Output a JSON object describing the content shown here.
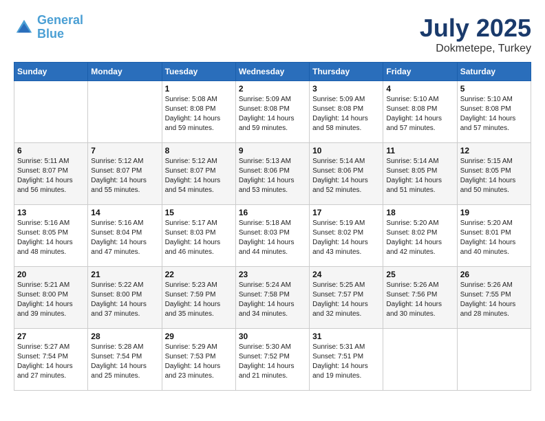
{
  "header": {
    "logo_line1": "General",
    "logo_line2": "Blue",
    "title": "July 2025",
    "subtitle": "Dokmetepe, Turkey"
  },
  "weekdays": [
    "Sunday",
    "Monday",
    "Tuesday",
    "Wednesday",
    "Thursday",
    "Friday",
    "Saturday"
  ],
  "weeks": [
    [
      {
        "day": "",
        "info": ""
      },
      {
        "day": "",
        "info": ""
      },
      {
        "day": "1",
        "info": "Sunrise: 5:08 AM\nSunset: 8:08 PM\nDaylight: 14 hours and 59 minutes."
      },
      {
        "day": "2",
        "info": "Sunrise: 5:09 AM\nSunset: 8:08 PM\nDaylight: 14 hours and 59 minutes."
      },
      {
        "day": "3",
        "info": "Sunrise: 5:09 AM\nSunset: 8:08 PM\nDaylight: 14 hours and 58 minutes."
      },
      {
        "day": "4",
        "info": "Sunrise: 5:10 AM\nSunset: 8:08 PM\nDaylight: 14 hours and 57 minutes."
      },
      {
        "day": "5",
        "info": "Sunrise: 5:10 AM\nSunset: 8:08 PM\nDaylight: 14 hours and 57 minutes."
      }
    ],
    [
      {
        "day": "6",
        "info": "Sunrise: 5:11 AM\nSunset: 8:07 PM\nDaylight: 14 hours and 56 minutes."
      },
      {
        "day": "7",
        "info": "Sunrise: 5:12 AM\nSunset: 8:07 PM\nDaylight: 14 hours and 55 minutes."
      },
      {
        "day": "8",
        "info": "Sunrise: 5:12 AM\nSunset: 8:07 PM\nDaylight: 14 hours and 54 minutes."
      },
      {
        "day": "9",
        "info": "Sunrise: 5:13 AM\nSunset: 8:06 PM\nDaylight: 14 hours and 53 minutes."
      },
      {
        "day": "10",
        "info": "Sunrise: 5:14 AM\nSunset: 8:06 PM\nDaylight: 14 hours and 52 minutes."
      },
      {
        "day": "11",
        "info": "Sunrise: 5:14 AM\nSunset: 8:05 PM\nDaylight: 14 hours and 51 minutes."
      },
      {
        "day": "12",
        "info": "Sunrise: 5:15 AM\nSunset: 8:05 PM\nDaylight: 14 hours and 50 minutes."
      }
    ],
    [
      {
        "day": "13",
        "info": "Sunrise: 5:16 AM\nSunset: 8:05 PM\nDaylight: 14 hours and 48 minutes."
      },
      {
        "day": "14",
        "info": "Sunrise: 5:16 AM\nSunset: 8:04 PM\nDaylight: 14 hours and 47 minutes."
      },
      {
        "day": "15",
        "info": "Sunrise: 5:17 AM\nSunset: 8:03 PM\nDaylight: 14 hours and 46 minutes."
      },
      {
        "day": "16",
        "info": "Sunrise: 5:18 AM\nSunset: 8:03 PM\nDaylight: 14 hours and 44 minutes."
      },
      {
        "day": "17",
        "info": "Sunrise: 5:19 AM\nSunset: 8:02 PM\nDaylight: 14 hours and 43 minutes."
      },
      {
        "day": "18",
        "info": "Sunrise: 5:20 AM\nSunset: 8:02 PM\nDaylight: 14 hours and 42 minutes."
      },
      {
        "day": "19",
        "info": "Sunrise: 5:20 AM\nSunset: 8:01 PM\nDaylight: 14 hours and 40 minutes."
      }
    ],
    [
      {
        "day": "20",
        "info": "Sunrise: 5:21 AM\nSunset: 8:00 PM\nDaylight: 14 hours and 39 minutes."
      },
      {
        "day": "21",
        "info": "Sunrise: 5:22 AM\nSunset: 8:00 PM\nDaylight: 14 hours and 37 minutes."
      },
      {
        "day": "22",
        "info": "Sunrise: 5:23 AM\nSunset: 7:59 PM\nDaylight: 14 hours and 35 minutes."
      },
      {
        "day": "23",
        "info": "Sunrise: 5:24 AM\nSunset: 7:58 PM\nDaylight: 14 hours and 34 minutes."
      },
      {
        "day": "24",
        "info": "Sunrise: 5:25 AM\nSunset: 7:57 PM\nDaylight: 14 hours and 32 minutes."
      },
      {
        "day": "25",
        "info": "Sunrise: 5:26 AM\nSunset: 7:56 PM\nDaylight: 14 hours and 30 minutes."
      },
      {
        "day": "26",
        "info": "Sunrise: 5:26 AM\nSunset: 7:55 PM\nDaylight: 14 hours and 28 minutes."
      }
    ],
    [
      {
        "day": "27",
        "info": "Sunrise: 5:27 AM\nSunset: 7:54 PM\nDaylight: 14 hours and 27 minutes."
      },
      {
        "day": "28",
        "info": "Sunrise: 5:28 AM\nSunset: 7:54 PM\nDaylight: 14 hours and 25 minutes."
      },
      {
        "day": "29",
        "info": "Sunrise: 5:29 AM\nSunset: 7:53 PM\nDaylight: 14 hours and 23 minutes."
      },
      {
        "day": "30",
        "info": "Sunrise: 5:30 AM\nSunset: 7:52 PM\nDaylight: 14 hours and 21 minutes."
      },
      {
        "day": "31",
        "info": "Sunrise: 5:31 AM\nSunset: 7:51 PM\nDaylight: 14 hours and 19 minutes."
      },
      {
        "day": "",
        "info": ""
      },
      {
        "day": "",
        "info": ""
      }
    ]
  ]
}
